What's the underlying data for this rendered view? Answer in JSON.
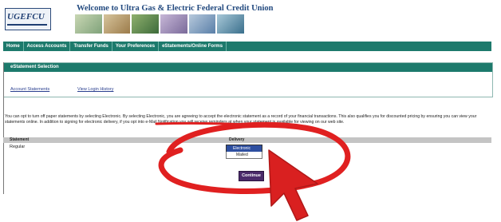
{
  "header": {
    "logo_text": "UGEFCU",
    "welcome": "Welcome to Ultra Gas & Electric Federal Credit Union"
  },
  "nav": {
    "items": [
      "Home",
      "Access Accounts",
      "Transfer Funds",
      "Your Preferences",
      "eStatements/Online Forms"
    ]
  },
  "statement": {
    "title": "eStatement Selection",
    "links": [
      "Account Statements",
      "View Login History"
    ]
  },
  "info_text": "You can opt to turn off paper statements by selecting Electronic. By selecting Electronic, you are agreeing to accept the electronic statement as a record of your financial transactions. This also qualifies you for discounted pricing by ensuring you can view your statements online. In addition to signing for electronic delivery, if you opt into e-Mail Notification you will receive reminders at when your statement is available for viewing on our web site.",
  "table": {
    "headers": [
      "Statement",
      "Delivery"
    ],
    "row_label": "Regular",
    "selected_option": "Electronic",
    "other_option": "Mailed"
  },
  "continue_label": "Continue",
  "colors": {
    "nav_bg": "#1d7a6c",
    "annotation_red": "#e02020",
    "select_highlight": "#2e4fa0"
  },
  "icons": {
    "cursor": "pointer-arrow-icon"
  }
}
